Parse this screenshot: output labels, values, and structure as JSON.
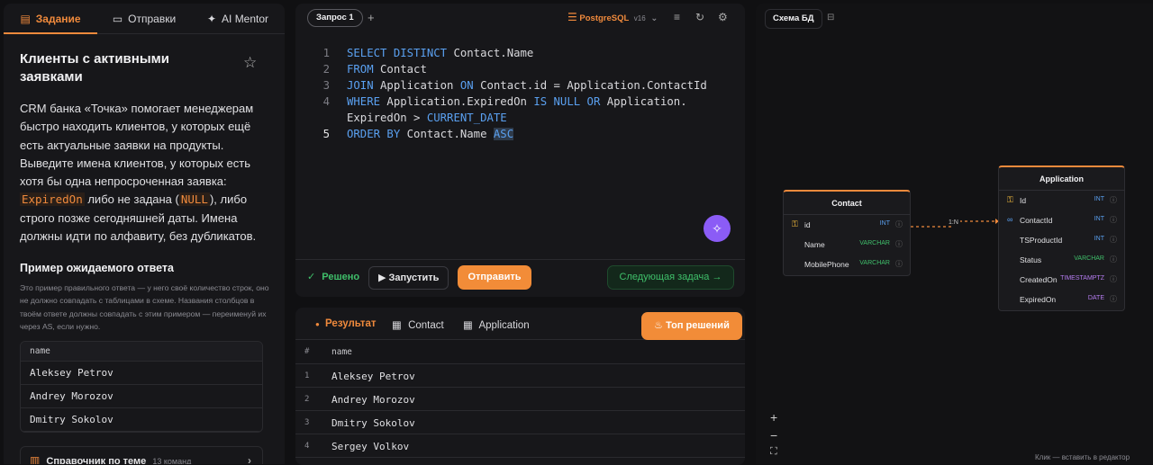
{
  "left_tabs": [
    {
      "label": "Задание",
      "icon": "document-icon"
    },
    {
      "label": "Отправки",
      "icon": "chat-icon"
    },
    {
      "label": "AI Mentor",
      "icon": "sparkle-icon"
    }
  ],
  "task": {
    "title": "Клиенты с активными заявками",
    "description_1": "CRM банка «Точка» помогает менеджерам быстро находить клиентов, у которых ещё есть актуальные заявки на продукты. Выведите имена клиентов, у которых есть хотя бы одна непросроченная заявка:",
    "code_1": "ExpiredOn",
    "description_2": " либо не задана (",
    "code_2": "NULL",
    "description_3": "), либо строго позже сегодняшней даты. Имена должны идти по алфавиту, без дубликатов."
  },
  "example": {
    "heading": "Пример ожидаемого ответа",
    "note": "Это пример правильного ответа — у него своё количество строк, оно не должно совпадать с таблицами в схеме. Названия столбцов в твоём ответе должны совпадать с этим примером — переименуй их через AS, если нужно.",
    "column": "name",
    "rows": [
      "Aleksey Petrov",
      "Andrey Morozov",
      "Dmitry Sokolov"
    ]
  },
  "reference": {
    "label": "Справочник по теме",
    "count": "13 команд"
  },
  "editor": {
    "query_tab": "Запрос 1",
    "add_tab": "+",
    "db_name": "PostgreSQL",
    "db_version": "v16",
    "line_numbers": [
      "1",
      "2",
      "3",
      "4",
      "5"
    ],
    "lines": {
      "l1_kw": "SELECT DISTINCT",
      "l1_rest": " Contact.Name",
      "l2_kw": "FROM",
      "l2_rest": " Contact",
      "l3_kw": "JOIN",
      "l3_a": " Application ",
      "l3_kw2": "ON",
      "l3_b": " Contact.id = Application.ContactId",
      "l4_kw": "WHERE",
      "l4_a": " Application.ExpiredOn ",
      "l4_kw2": "IS NULL OR",
      "l4_b": " Application.",
      "l4w_a": "ExpiredOn > ",
      "l4w_kw": "CURRENT_DATE",
      "l5_kw": "ORDER BY",
      "l5_a": " Contact.Name ",
      "l5_sel": "ASC"
    },
    "status": "Решено",
    "run_label": "Запустить",
    "submit_label": "Отправить",
    "next_label": "Следующая задача →"
  },
  "results": {
    "tabs": [
      "Результат",
      "Contact",
      "Application"
    ],
    "top_label": "Топ решений",
    "header_num": "#",
    "header_col": "name",
    "rows": [
      {
        "n": "1",
        "name": "Aleksey Petrov"
      },
      {
        "n": "2",
        "name": "Andrey Morozov"
      },
      {
        "n": "3",
        "name": "Dmitry Sokolov"
      },
      {
        "n": "4",
        "name": "Sergey Volkov"
      }
    ]
  },
  "schema": {
    "title": "Схема БД",
    "relation": "1:N",
    "contact": {
      "name": "Contact",
      "columns": [
        {
          "name": "id",
          "type": "INT"
        },
        {
          "name": "Name",
          "type": "VARCHAR"
        },
        {
          "name": "MobilePhone",
          "type": "VARCHAR"
        }
      ]
    },
    "application": {
      "name": "Application",
      "columns": [
        {
          "name": "Id",
          "type": "INT"
        },
        {
          "name": "ContactId",
          "type": "INT"
        },
        {
          "name": "TSProductId",
          "type": "INT"
        },
        {
          "name": "Status",
          "type": "VARCHAR"
        },
        {
          "name": "CreatedOn",
          "type": "TIMESTAMPTZ"
        },
        {
          "name": "ExpiredOn",
          "type": "DATE"
        }
      ]
    },
    "zoom_in": "+",
    "zoom_out": "−",
    "fit": "⛶",
    "hint": "Клик — вставить в редактор"
  },
  "colors": {
    "accent": "#f08a3c",
    "success": "#3fbf6a",
    "keyword": "#5aa0f0",
    "magic": "#8b5cf6"
  }
}
